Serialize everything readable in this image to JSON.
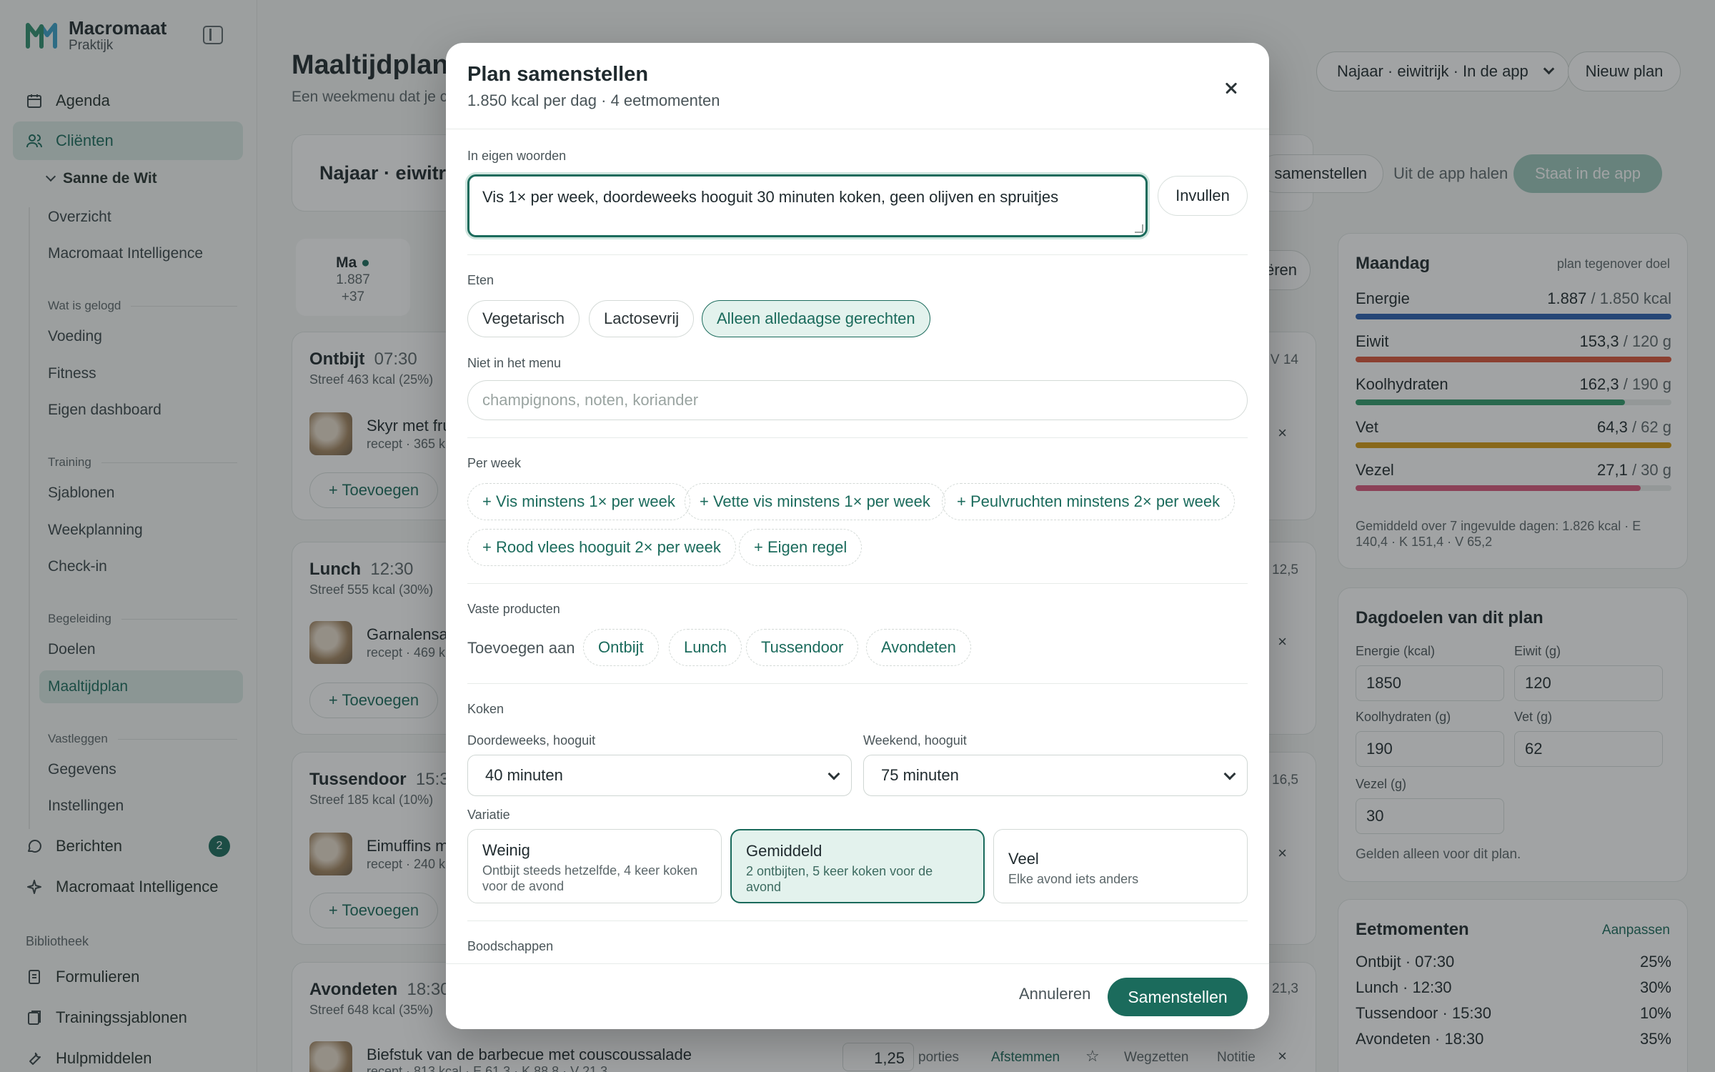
{
  "app": {
    "name": "Macromaat",
    "subtitle": "Praktijk"
  },
  "sidebar": {
    "agenda": "Agenda",
    "clients": "Cliënten",
    "client_name": "Sanne de Wit",
    "overview": "Overzicht",
    "intelligence_sub": "Macromaat Intelligence",
    "section_logged": "Wat is gelogd",
    "voeding": "Voeding",
    "fitness": "Fitness",
    "dashboard": "Eigen dashboard",
    "section_training": "Training",
    "sjablonen": "Sjablonen",
    "weekplanning": "Weekplanning",
    "checkin": "Check-in",
    "section_begeleiding": "Begeleiding",
    "doelen": "Doelen",
    "maaltijdplan": "Maaltijdplan",
    "section_vastleggen": "Vastleggen",
    "gegevens": "Gegevens",
    "instellingen": "Instellingen",
    "berichten": "Berichten",
    "berichten_count": "2",
    "intelligence": "Macromaat Intelligence",
    "section_bibliotheek": "Bibliotheek",
    "formulieren": "Formulieren",
    "trainingssjablonen": "Trainingssjablonen",
    "hulpmiddelen": "Hulpmiddelen"
  },
  "main": {
    "title": "Maaltijdplan",
    "subtitle": "Een weekmenu dat je c",
    "plan_select": "Najaar · eiwitrijk · In de app",
    "new_plan": "Nieuw plan",
    "plan_name": "Najaar · eiwitri",
    "compose_btn": "samenstellen",
    "remove_btn": "Uit de app halen",
    "in_app_btn": "Staat in de app",
    "export_btn": "ëren",
    "day": {
      "label": "Ma",
      "kcal": "1.887",
      "diff": "+37"
    },
    "meals": [
      {
        "name": "Ontbijt",
        "time": "07:30",
        "target": "Streef 463 kcal (25%)",
        "item": "Skyr met fru",
        "meta": "recept · 365 k",
        "add": "+ Toevoegen",
        "num": "V 14"
      },
      {
        "name": "Lunch",
        "time": "12:30",
        "target": "Streef 555 kcal (30%)",
        "item": "Garnalensa",
        "meta": "recept · 469 k",
        "add": "+ Toevoegen",
        "num": "12,5"
      },
      {
        "name": "Tussendoor",
        "time": "15:30",
        "target": "Streef 185 kcal (10%)",
        "item": "Eimuffins m",
        "meta": "recept · 240 k",
        "add": "+ Toevoegen",
        "num": "16,5"
      },
      {
        "name": "Avondeten",
        "time": "18:30",
        "target": "Streef 648 kcal (35%)",
        "item": "Biefstuk van de barbecue met couscoussalade",
        "meta": "recept · 813 kcal · E 61,3 · K 88,8 · V 21,3",
        "num": "21,3"
      }
    ],
    "dinner_row": {
      "portions": "1,25",
      "portions_label": "porties",
      "tune": "Afstemmen",
      "star": "☆",
      "remove": "Wegzetten",
      "note": "Notitie",
      "x": "×"
    }
  },
  "right": {
    "day_title": "Maandag",
    "day_note": "plan tegenover doel",
    "macros": [
      {
        "name": "Energie",
        "value": "1.887",
        "target": "/ 1.850 kcal",
        "fill": 1.0,
        "color": "#2a5fb0"
      },
      {
        "name": "Eiwit",
        "value": "153,3",
        "target": "/ 120 g",
        "fill": 1.0,
        "color": "#d9553a"
      },
      {
        "name": "Koolhydraten",
        "value": "162,3",
        "target": "/ 190 g",
        "fill": 0.854,
        "color": "#2f9a6a"
      },
      {
        "name": "Vet",
        "value": "64,3",
        "target": "/ 62 g",
        "fill": 1.0,
        "color": "#d59a12"
      },
      {
        "name": "Vezel",
        "value": "27,1",
        "target": "/ 30 g",
        "fill": 0.903,
        "color": "#d9567a"
      }
    ],
    "average": "Gemiddeld over 7 ingevulde dagen: 1.826 kcal · E 140,4 · K 151,4 · V 65,2",
    "goals_title": "Dagdoelen van dit plan",
    "goals": {
      "energy_label": "Energie (kcal)",
      "energy": "1850",
      "protein_label": "Eiwit (g)",
      "protein": "120",
      "carbs_label": "Koolhydraten (g)",
      "carbs": "190",
      "fat_label": "Vet (g)",
      "fat": "62",
      "fiber_label": "Vezel (g)",
      "fiber": "30"
    },
    "goals_note": "Gelden alleen voor dit plan.",
    "meals_title": "Eetmomenten",
    "meals_edit": "Aanpassen",
    "meal_moments": [
      {
        "label": "Ontbijt · 07:30",
        "pct": "25%"
      },
      {
        "label": "Lunch · 12:30",
        "pct": "30%"
      },
      {
        "label": "Tussendoor · 15:30",
        "pct": "10%"
      },
      {
        "label": "Avondeten · 18:30",
        "pct": "35%"
      }
    ]
  },
  "modal": {
    "title": "Plan samenstellen",
    "subtitle": "1.850 kcal per dag · 4 eetmomenten",
    "own_words_label": "In eigen woorden",
    "own_words_value": "Vis 1× per week, doordeweeks hooguit 30 minuten koken, geen olijven en spruitjes",
    "fill_btn": "Invullen",
    "eat_label": "Eten",
    "eat_chips": [
      "Vegetarisch",
      "Lactosevrij",
      "Alleen alledaagse gerechten"
    ],
    "exclude_label": "Niet in het menu",
    "exclude_placeholder": "champignons, noten, koriander",
    "week_label": "Per week",
    "week_chips": [
      "+ Vis minstens 1× per week",
      "+ Vette vis minstens 1× per week",
      "+ Peulvruchten minstens 2× per week",
      "+ Rood vlees hooguit 2× per week",
      "+ Eigen regel"
    ],
    "fixed_label": "Vaste producten",
    "fixed_add": "Toevoegen aan",
    "fixed_chips": [
      "Ontbijt",
      "Lunch",
      "Tussendoor",
      "Avondeten"
    ],
    "cook_label": "Koken",
    "weekday_label": "Doordeweeks, hooguit",
    "weekday_value": "40 minuten",
    "weekend_label": "Weekend, hooguit",
    "weekend_value": "75 minuten",
    "variation_label": "Variatie",
    "variations": [
      {
        "title": "Weinig",
        "desc": "Ontbijt steeds hetzelfde, 4 keer koken voor de avond"
      },
      {
        "title": "Gemiddeld",
        "desc": "2 ontbijten, 5 keer koken voor de avond"
      },
      {
        "title": "Veel",
        "desc": "Elke avond iets anders"
      }
    ],
    "shopping_label": "Boodschappen",
    "cancel": "Annuleren",
    "submit": "Samenstellen"
  }
}
